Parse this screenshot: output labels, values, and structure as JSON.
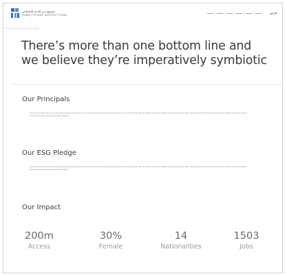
{
  "header": {
    "logo_ar": "صندوق دبي للدعم الاجتماعي",
    "logo_en": "DUBAI FUTURE DISTRICT FUND",
    "nav_items": [
      "",
      "",
      "",
      "",
      "",
      ""
    ],
    "lang": "عربي"
  },
  "breadcrumb": "Home / About / Sustainable investing",
  "hero": {
    "title": "There’s more than one bottom line and we believe they’re imperatively symbiotic"
  },
  "sections": {
    "principals": {
      "heading": "Our Principals",
      "body": "Lorem ipsum is simply dummy text of the printing and typesetting industry. Lorem Ipsum has been the industry's standard dummy text ever since the 1500s, when an unknown printer took a galley of type and scrambled it to make a type specimen book. It has survived not only five centuries, but also the leap into electronic typesetting, remaining essentially unchanged."
    },
    "esg": {
      "heading": "Our ESG Pledge",
      "body": "Lorem ipsum is simply dummy text of the printing and typesetting industry. Lorem Ipsum has been the industry's standard dummy text ever since the 1500s, when an unknown printer took a galley of type and scrambled it to make a type specimen book. It has survived not only five centuries, but also the leap into electronic typesetting, remaining essentially unchanged."
    },
    "impact": {
      "heading": "Our Impact"
    }
  },
  "stats": [
    {
      "value": "200m",
      "label": "Access"
    },
    {
      "value": "30%",
      "label": "Female"
    },
    {
      "value": "14",
      "label": "Nationalities"
    },
    {
      "value": "1503",
      "label": "Jobs"
    }
  ],
  "colors": {
    "brand_blue": "#2a6fb0",
    "text_dark": "#3a3a3a",
    "stat_text": "#6a6a6a"
  }
}
